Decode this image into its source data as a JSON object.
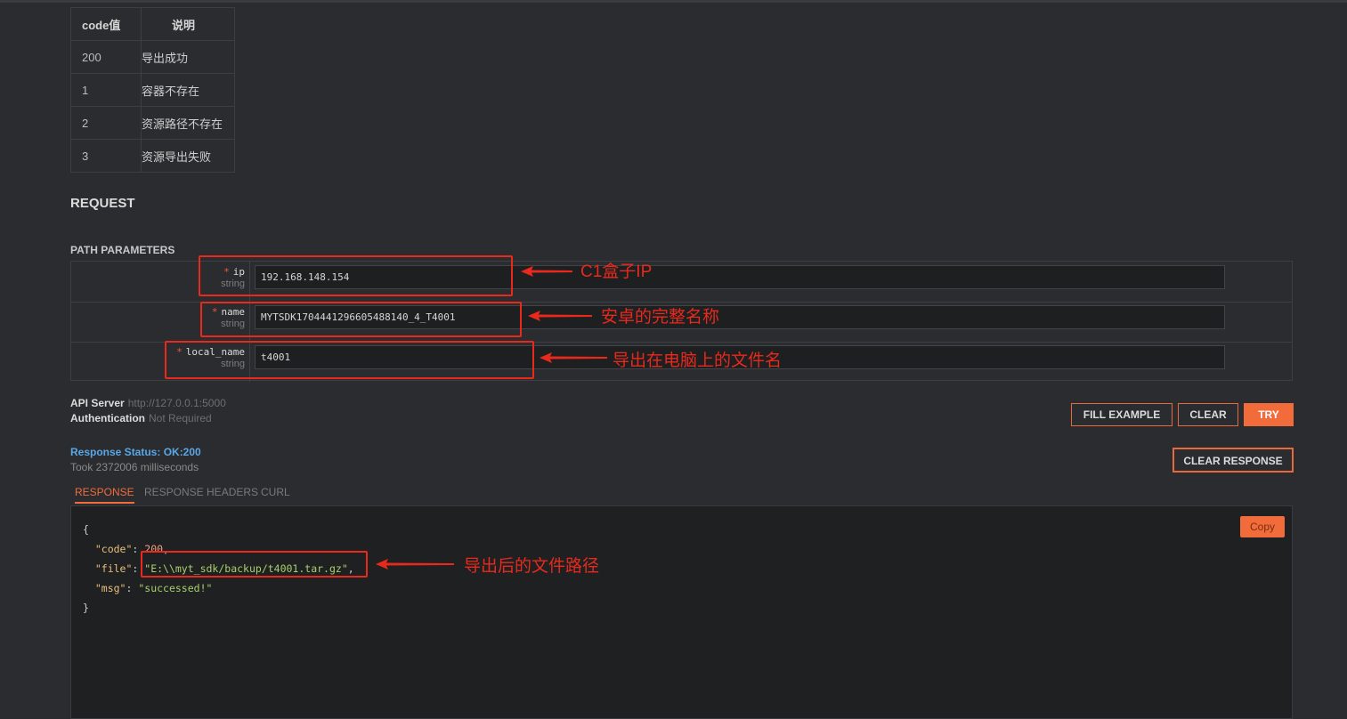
{
  "code_table": {
    "headers": [
      "code值",
      "说明"
    ],
    "rows": [
      [
        "200",
        "导出成功"
      ],
      [
        "1",
        "容器不存在"
      ],
      [
        "2",
        "资源路径不存在"
      ],
      [
        "3",
        "资源导出失败"
      ]
    ]
  },
  "request": {
    "title": "REQUEST",
    "path_params_title": "PATH PARAMETERS",
    "required_marker": "*",
    "params": [
      {
        "name": "ip",
        "type": "string",
        "value": "192.168.148.154",
        "annotation": "C1盒子IP"
      },
      {
        "name": "name",
        "type": "string",
        "value": "MYTSDK1704441296605488140_4_T4001",
        "annotation": "安卓的完整名称"
      },
      {
        "name": "local_name",
        "type": "string",
        "value": "t4001",
        "annotation": "导出在电脑上的文件名"
      }
    ]
  },
  "server": {
    "api_label": "API Server",
    "api_value": "http://127.0.0.1:5000",
    "auth_label": "Authentication",
    "auth_value": "Not Required"
  },
  "buttons": {
    "fill_example": "FILL EXAMPLE",
    "clear": "CLEAR",
    "try": "TRY",
    "clear_response": "CLEAR RESPONSE",
    "copy": "Copy"
  },
  "response": {
    "status": "Response Status: OK:200",
    "took": "Took 2372006 milliseconds",
    "tabs": [
      "RESPONSE",
      "RESPONSE HEADERS",
      "CURL"
    ],
    "json": {
      "open": "{",
      "close": "}",
      "code_key": "\"code\"",
      "code_val": "200",
      "file_key": "\"file\"",
      "file_val": "\"E:\\\\myt_sdk/backup/t4001.tar.gz\"",
      "msg_key": "\"msg\"",
      "msg_val": "\"successed!\""
    },
    "file_annotation": "导出后的文件路径"
  },
  "colors": {
    "accent": "#f26b3a",
    "annotation": "#e8291c",
    "status": "#5aa7e6",
    "background": "#2b2c2f"
  }
}
